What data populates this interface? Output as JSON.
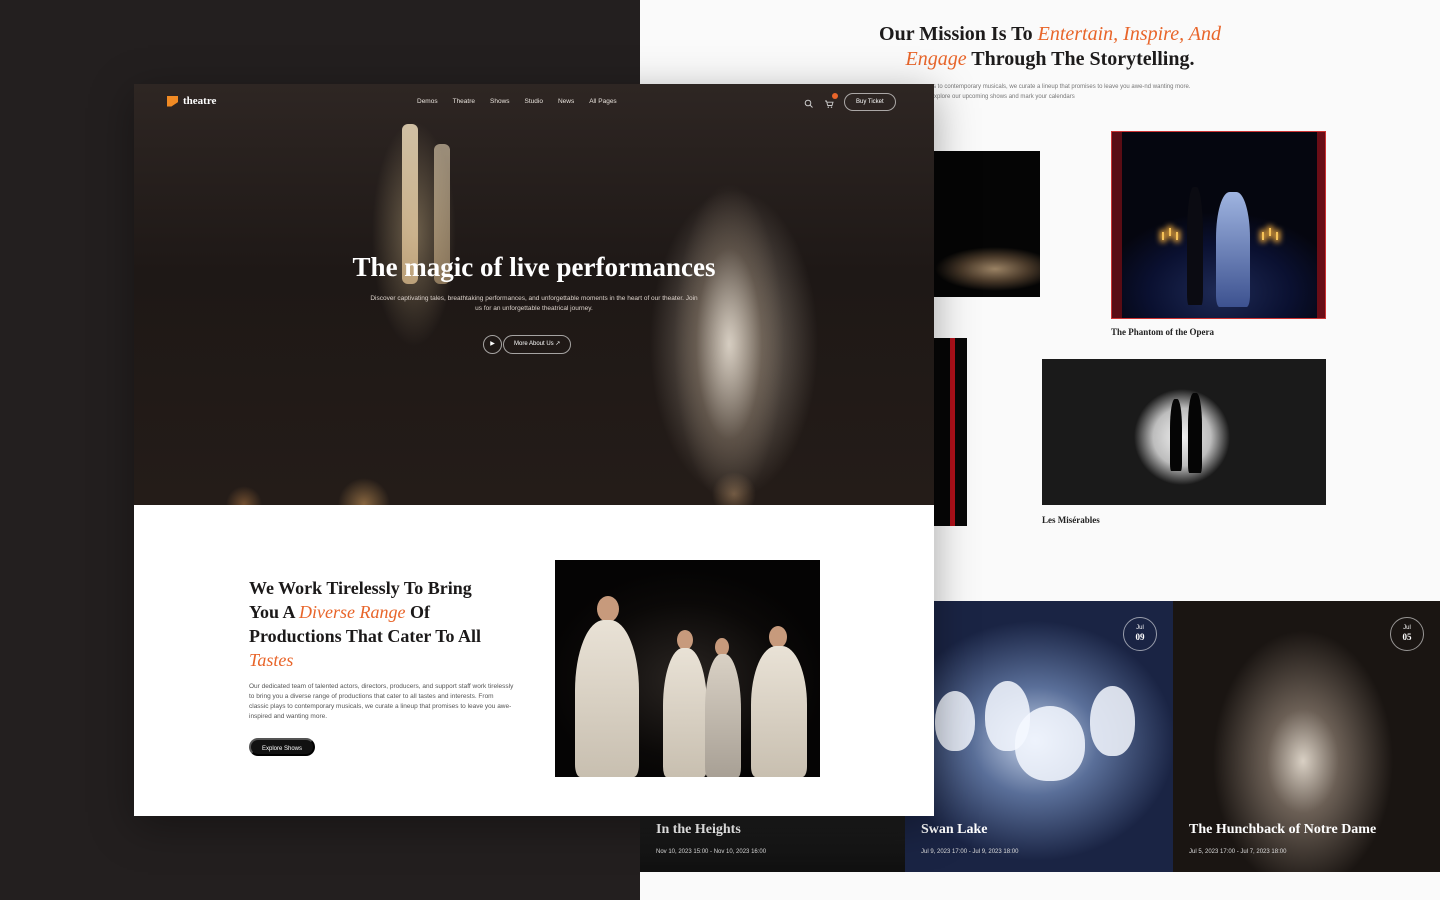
{
  "back": {
    "mission": {
      "title_start": "Our Mission Is To ",
      "title_accent_1": "Entertain, Inspire, And",
      "title_accent_2": "Engage",
      "title_end": " Through The Storytelling.",
      "description": "ys to contemporary musicals, we curate a lineup that promises to leave you awe-nd wanting more. Explore our upcoming shows and mark your calendars"
    },
    "shows": [
      {
        "caption": "The Phantom of the Opera"
      },
      {
        "caption": "Les Misérables"
      }
    ],
    "events": [
      {
        "title": "In the Heights",
        "date": "Nov 10, 2023 15:00 - Nov 10, 2023 16:00"
      },
      {
        "title": "Swan Lake",
        "date": "Jul 9, 2023 17:00 - Jul 9, 2023 18:00",
        "badge_month": "Jul",
        "badge_day": "09"
      },
      {
        "title": "The Hunchback of Notre Dame",
        "date": "Jul 5, 2023 17:00 - Jul 7, 2023 18:00",
        "badge_month": "Jul",
        "badge_day": "05"
      }
    ]
  },
  "front": {
    "logo": "theatre",
    "nav": [
      "Demos",
      "Theatre",
      "Shows",
      "Studio",
      "News",
      "All Pages"
    ],
    "buy_ticket": "Buy Ticket",
    "hero": {
      "title": "The magic of live performances",
      "description": "Discover captivating tales, breathtaking performances, and unforgettable moments in the heart of our theater. Join us for an unforgettable theatrical journey.",
      "more_button": "More About Us  ↗",
      "play_icon": "▶"
    },
    "about": {
      "title_1": "We Work Tirelessly To Bring",
      "title_2a": "You A ",
      "title_2_accent": "Diverse Range",
      "title_2b": " Of",
      "title_3": "Productions That Cater To All",
      "title_4_accent": "Tastes",
      "description": "Our dedicated team of talented actors, directors, producers, and support staff work tirelessly to bring you a diverse range of productions that cater to all tastes and interests. From classic plays to contemporary musicals, we curate a lineup that promises to leave you awe-inspired and wanting more.",
      "explore_button": "Explore Shows"
    }
  },
  "colors": {
    "accent": "#e8652a",
    "dark_bg": "#231f1f",
    "logo": "#f08a24"
  },
  "icons": [
    "logo-icon",
    "search-icon",
    "cart-icon",
    "play-icon",
    "arrow-up-right-icon"
  ]
}
